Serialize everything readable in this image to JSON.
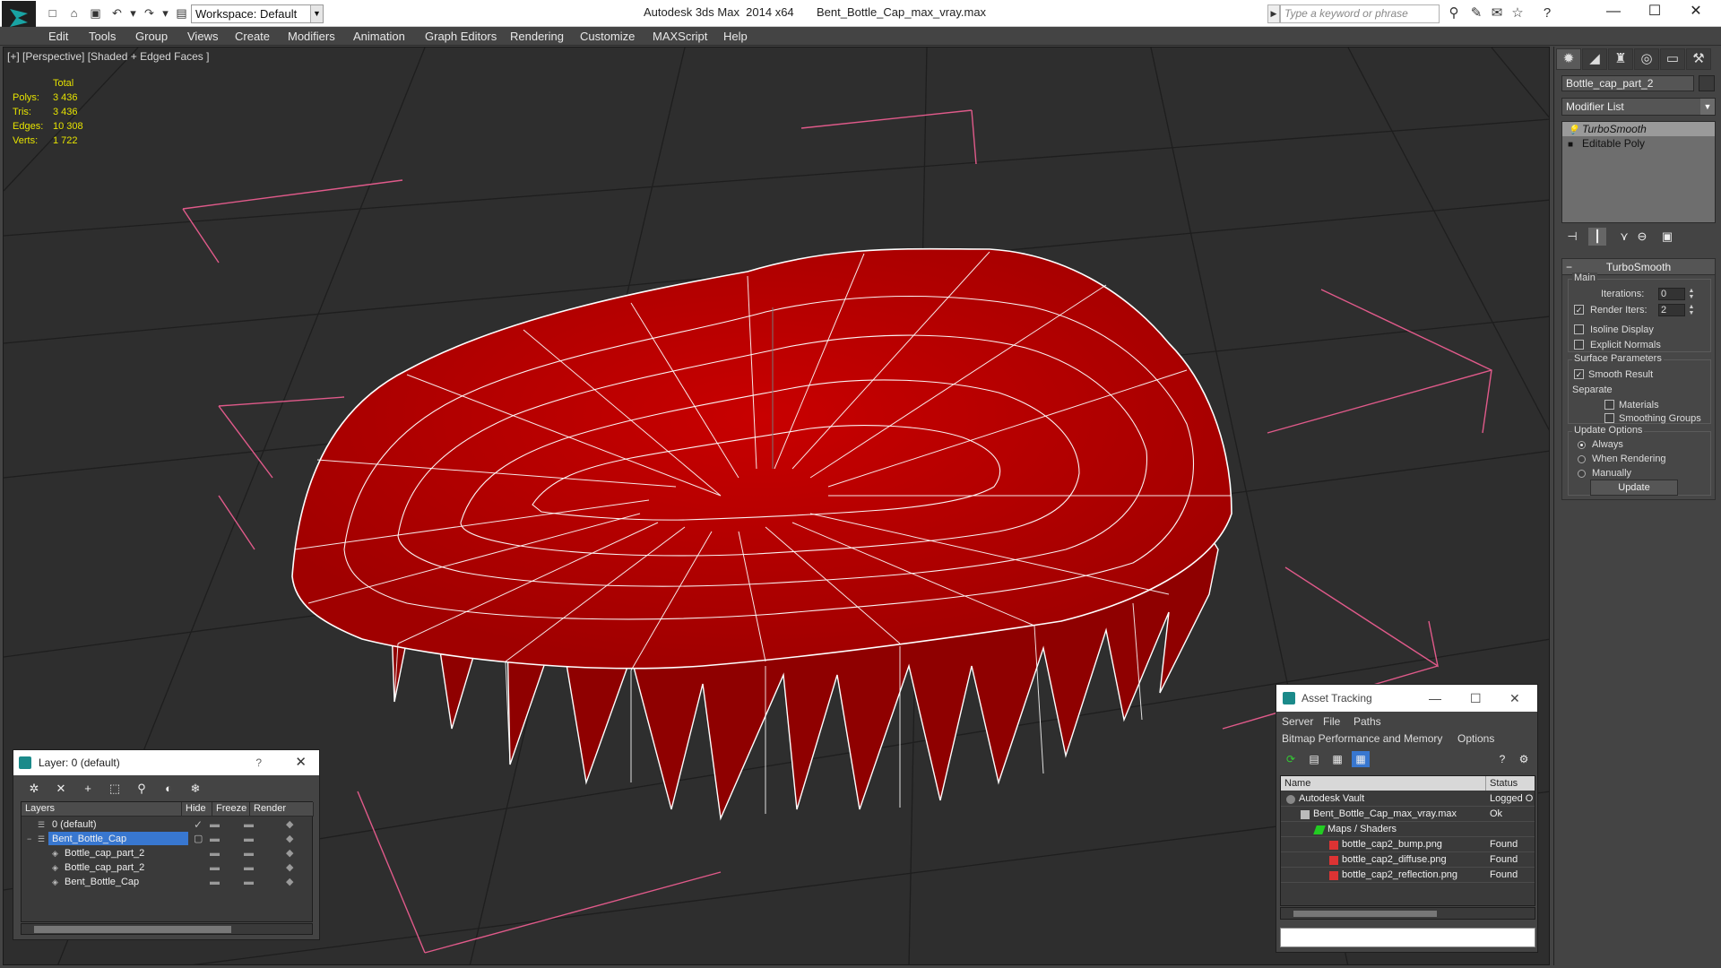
{
  "titlebar": {
    "workspace_label": "Workspace: Default",
    "app_title": "Autodesk 3ds Max  2014 x64",
    "file_name": "Bent_Bottle_Cap_max_vray.max",
    "search_placeholder": "Type a keyword or phrase"
  },
  "menu": [
    "Edit",
    "Tools",
    "Group",
    "Views",
    "Create",
    "Modifiers",
    "Animation",
    "Graph Editors",
    "Rendering",
    "Customize",
    "MAXScript",
    "Help"
  ],
  "viewport": {
    "label": "[+] [Perspective] [Shaded + Edged Faces ]",
    "stats": {
      "header": "Total",
      "rows": [
        {
          "key": "Polys:",
          "value": "3 436"
        },
        {
          "key": "Tris:",
          "value": "3 436"
        },
        {
          "key": "Edges:",
          "value": "10 308"
        },
        {
          "key": "Verts:",
          "value": "1 722"
        }
      ]
    },
    "model_color": "#c10000",
    "wire_color": "#ffffff",
    "grid_color": "#1e1e1e",
    "bbox_color": "#e05a8a"
  },
  "command_panel": {
    "object_name": "Bottle_cap_part_2",
    "modifier_list": "Modifier List",
    "stack": [
      "TurboSmooth",
      "Editable Poly"
    ],
    "turbosmooth": {
      "title": "TurboSmooth",
      "main_label": "Main",
      "iterations_label": "Iterations:",
      "iterations_value": "0",
      "render_iters_label": "Render Iters:",
      "render_iters_value": "2",
      "isoline_label": "Isoline Display",
      "explicit_normals_label": "Explicit Normals",
      "surface_label": "Surface Parameters",
      "smooth_result_label": "Smooth Result",
      "separate_label": "Separate",
      "materials_label": "Materials",
      "smoothing_groups_label": "Smoothing Groups",
      "update_options_label": "Update Options",
      "always_label": "Always",
      "when_rendering_label": "When Rendering",
      "manually_label": "Manually",
      "update_button": "Update"
    }
  },
  "layer_dialog": {
    "title": "Layer: 0 (default)",
    "help": "?",
    "columns": [
      "Layers",
      "Hide",
      "Freeze",
      "Render"
    ],
    "rows": [
      {
        "name": "0 (default)"
      },
      {
        "name": "Bent_Bottle_Cap"
      },
      {
        "name": "Bottle_cap_part_2"
      },
      {
        "name": "Bottle_cap_part_2"
      },
      {
        "name": "Bent_Bottle_Cap"
      }
    ]
  },
  "asset_dialog": {
    "title": "Asset Tracking",
    "menu1": [
      "Server",
      "File",
      "Paths"
    ],
    "menu2": [
      "Bitmap Performance and Memory",
      "Options"
    ],
    "columns": [
      "Name",
      "Status"
    ],
    "rows": [
      {
        "name": "Autodesk Vault",
        "status": "Logged O"
      },
      {
        "name": "Bent_Bottle_Cap_max_vray.max",
        "status": "Ok"
      },
      {
        "name": "Maps / Shaders",
        "status": ""
      },
      {
        "name": "bottle_cap2_bump.png",
        "status": "Found"
      },
      {
        "name": "bottle_cap2_diffuse.png",
        "status": "Found"
      },
      {
        "name": "bottle_cap2_reflection.png",
        "status": "Found"
      }
    ]
  }
}
